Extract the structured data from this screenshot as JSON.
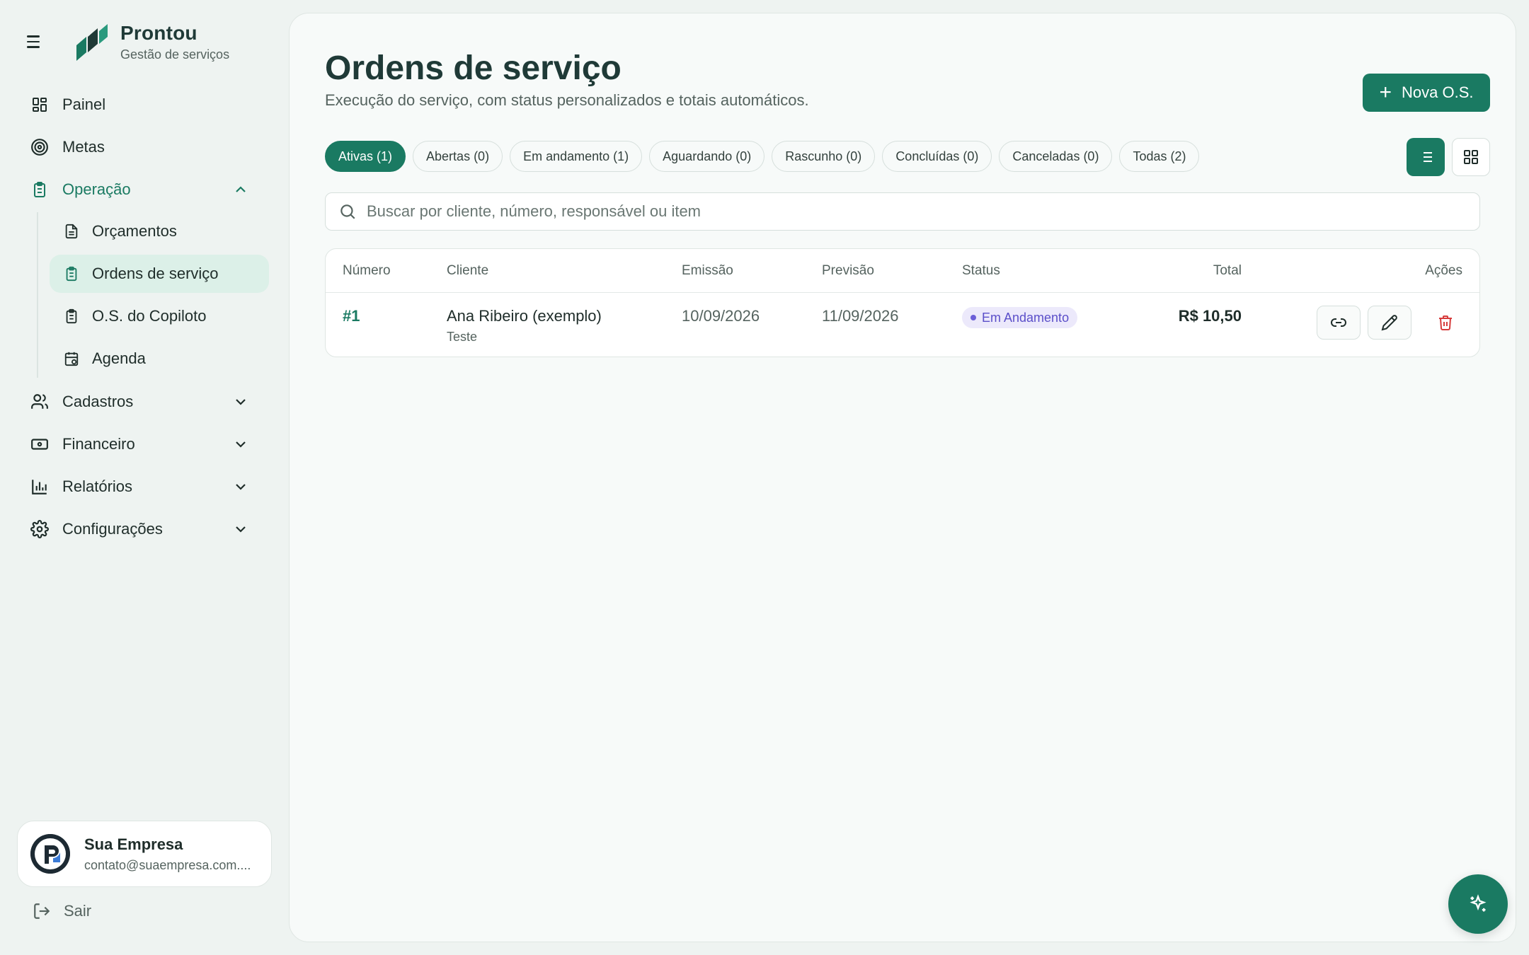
{
  "brand": {
    "title": "Prontou",
    "subtitle": "Gestão de serviços"
  },
  "nav": {
    "painel": "Painel",
    "metas": "Metas",
    "operacao": "Operação",
    "sub": {
      "orcamentos": "Orçamentos",
      "ordens": "Ordens de serviço",
      "copiloto": "O.S. do Copiloto",
      "agenda": "Agenda"
    },
    "cadastros": "Cadastros",
    "financeiro": "Financeiro",
    "relatorios": "Relatórios",
    "configuracoes": "Configurações"
  },
  "account": {
    "name": "Sua Empresa",
    "email": "contato@suaempresa.com...."
  },
  "logout": "Sair",
  "page": {
    "title": "Ordens de serviço",
    "subtitle": "Execução do serviço, com status personalizados e totais automáticos.",
    "new_button": "Nova O.S."
  },
  "filters": [
    "Ativas (1)",
    "Abertas (0)",
    "Em andamento (1)",
    "Aguardando (0)",
    "Rascunho (0)",
    "Concluídas (0)",
    "Canceladas (0)",
    "Todas (2)"
  ],
  "search": {
    "placeholder": "Buscar por cliente, número, responsável ou item"
  },
  "table": {
    "headers": {
      "numero": "Número",
      "cliente": "Cliente",
      "emissao": "Emissão",
      "previsao": "Previsão",
      "status": "Status",
      "total": "Total",
      "acoes": "Ações"
    },
    "rows": [
      {
        "numero": "#1",
        "cliente": "Ana Ribeiro (exemplo)",
        "cliente_sub": "Teste",
        "emissao": "10/09/2026",
        "previsao": "11/09/2026",
        "status": "Em Andamento",
        "total": "R$ 10,50"
      }
    ]
  },
  "colors": {
    "accent": "#1a7a62",
    "status_badge": "#5b4fc9",
    "danger": "#d63b3b"
  }
}
